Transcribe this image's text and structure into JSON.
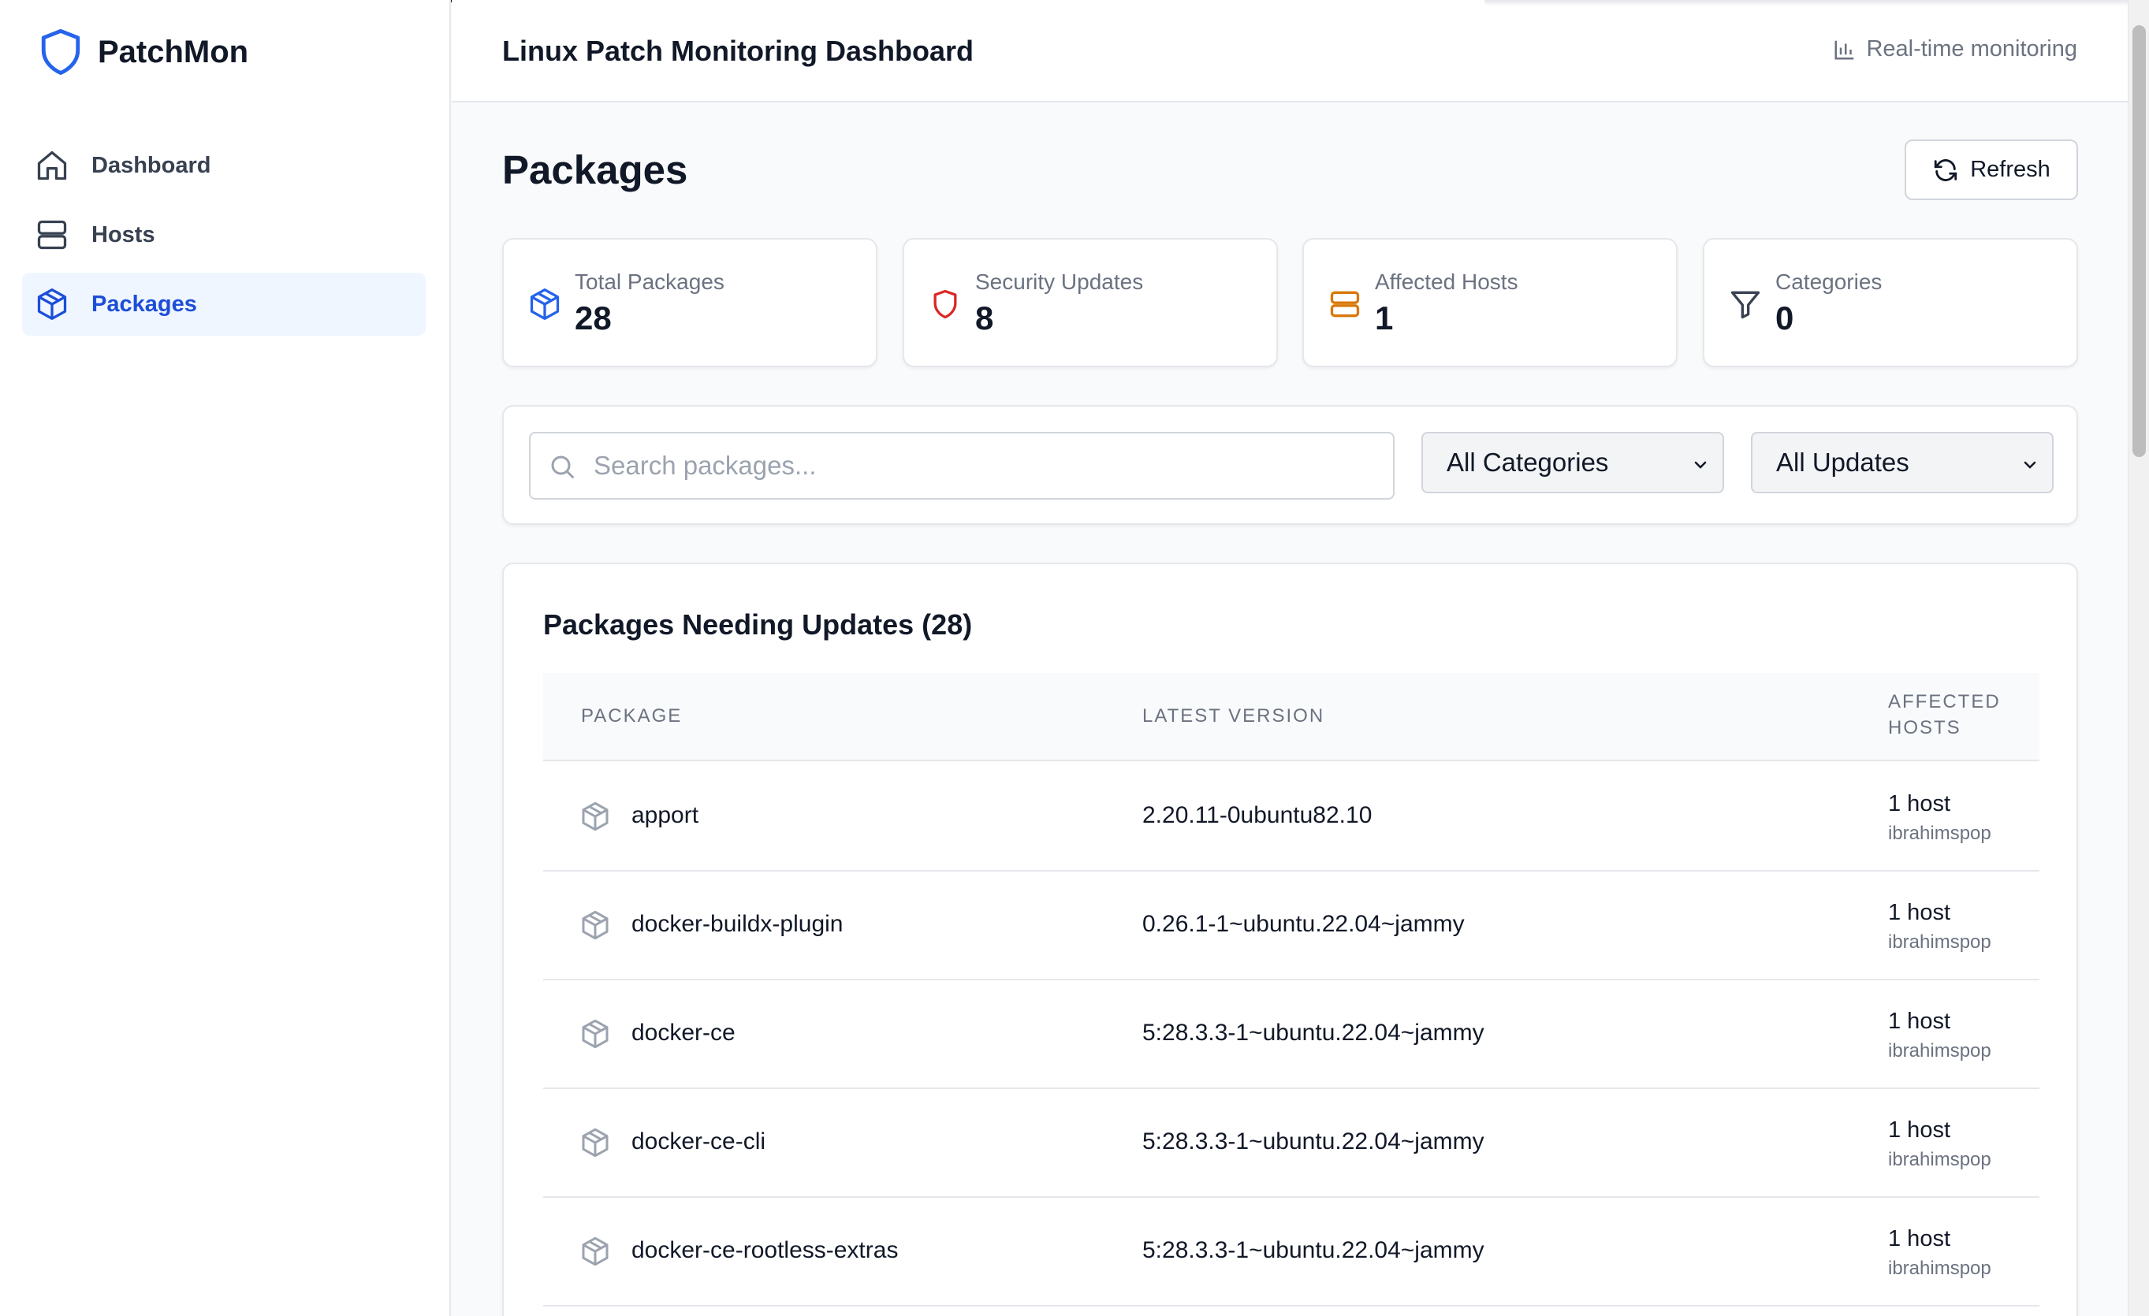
{
  "app": {
    "name": "PatchMon",
    "header_title": "Linux Patch Monitoring Dashboard",
    "realtime_label": "Real-time monitoring"
  },
  "sidebar": {
    "items": [
      {
        "label": "Dashboard",
        "icon": "home-icon",
        "active": false
      },
      {
        "label": "Hosts",
        "icon": "server-icon",
        "active": false
      },
      {
        "label": "Packages",
        "icon": "package-icon",
        "active": true
      }
    ]
  },
  "page": {
    "title": "Packages",
    "refresh_label": "Refresh"
  },
  "stats": [
    {
      "label": "Total Packages",
      "value": "28",
      "icon": "package-icon",
      "color": "#2563eb"
    },
    {
      "label": "Security Updates",
      "value": "8",
      "icon": "shield-icon",
      "color": "#dc2626"
    },
    {
      "label": "Affected Hosts",
      "value": "1",
      "icon": "server-icon",
      "color": "#d97706"
    },
    {
      "label": "Categories",
      "value": "0",
      "icon": "filter-icon",
      "color": "#374151"
    }
  ],
  "filters": {
    "search_placeholder": "Search packages...",
    "search_value": "",
    "category_selected": "All Categories",
    "updates_selected": "All Updates"
  },
  "table": {
    "title": "Packages Needing Updates (28)",
    "columns": {
      "package": "PACKAGE",
      "latest_version": "LATEST VERSION",
      "affected_hosts_line1": "AFFECTED",
      "affected_hosts_line2": "HOSTS"
    },
    "rows": [
      {
        "name": "apport",
        "version": "2.20.11-0ubuntu82.10",
        "hosts": "1 host",
        "host_name": "ibrahimspop"
      },
      {
        "name": "docker-buildx-plugin",
        "version": "0.26.1-1~ubuntu.22.04~jammy",
        "hosts": "1 host",
        "host_name": "ibrahimspop"
      },
      {
        "name": "docker-ce",
        "version": "5:28.3.3-1~ubuntu.22.04~jammy",
        "hosts": "1 host",
        "host_name": "ibrahimspop"
      },
      {
        "name": "docker-ce-cli",
        "version": "5:28.3.3-1~ubuntu.22.04~jammy",
        "hosts": "1 host",
        "host_name": "ibrahimspop"
      },
      {
        "name": "docker-ce-rootless-extras",
        "version": "5:28.3.3-1~ubuntu.22.04~jammy",
        "hosts": "1 host",
        "host_name": "ibrahimspop"
      }
    ]
  },
  "colors": {
    "brand": "#2563eb",
    "active_bg": "#eff6ff",
    "security": "#dc2626",
    "hosts": "#d97706"
  }
}
